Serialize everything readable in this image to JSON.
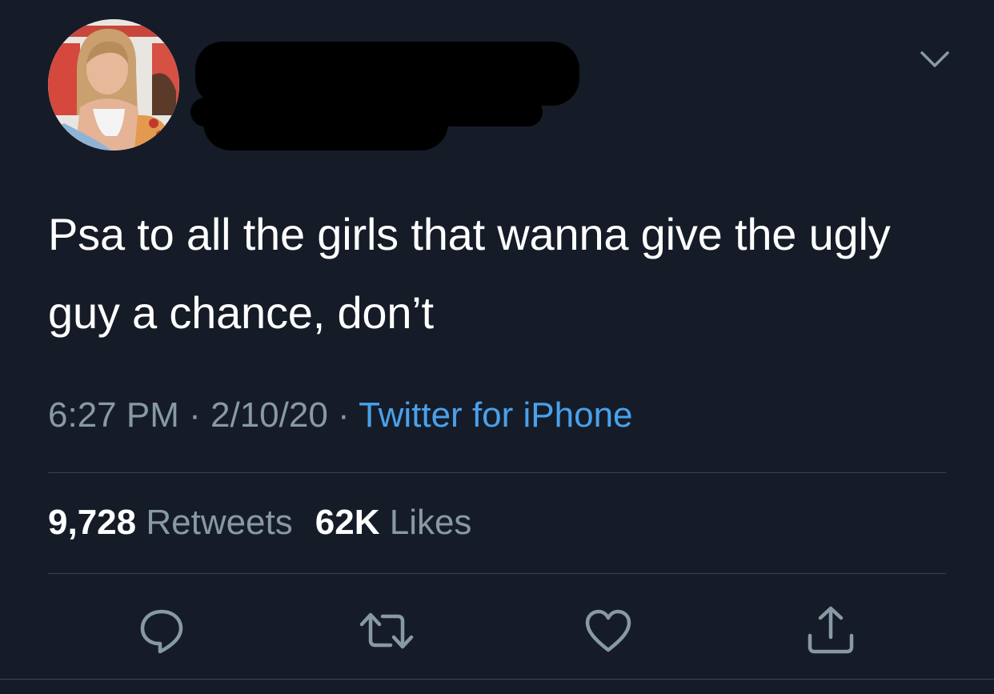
{
  "colors": {
    "background": "#151c28",
    "text_primary": "#ffffff",
    "text_secondary": "#8899a6",
    "link": "#4aa1eb",
    "divider": "#38444d"
  },
  "tweet": {
    "text": "Psa to all the girls that wanna give the ugly guy a chance, don’t",
    "time": "6:27 PM",
    "date": "2/10/20",
    "separator": "·",
    "source": "Twitter for iPhone"
  },
  "stats": {
    "retweets_count": "9,728",
    "retweets_label": "Retweets",
    "likes_count": "62K",
    "likes_label": "Likes"
  },
  "icons": {
    "more": "chevron-down-icon",
    "reply": "reply-icon",
    "retweet": "retweet-icon",
    "like": "heart-icon",
    "share": "share-icon"
  }
}
